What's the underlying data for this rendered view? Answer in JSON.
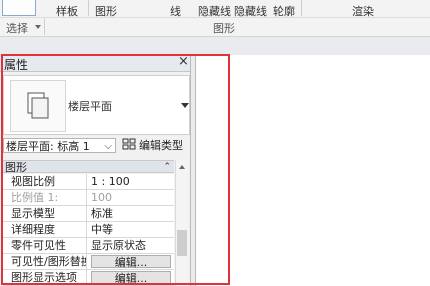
{
  "ribbon": {
    "row1": [
      "样板",
      "图形",
      "线",
      "隐藏线",
      "隐藏线",
      "轮廓",
      "渲染"
    ],
    "select_label": "选择",
    "group_label": "图形"
  },
  "properties": {
    "title": "属性",
    "close_glyph": "×",
    "type_name": "楼层平面",
    "view_selector": "楼层平面: 标高 1",
    "edit_type": "编辑类型",
    "group": "图形",
    "rows": [
      {
        "name": "视图比例",
        "value": "1 : 100",
        "dim": false
      },
      {
        "name": "比例值 1:",
        "value": "100",
        "dim": true
      },
      {
        "name": "显示模型",
        "value": "标准",
        "dim": false
      },
      {
        "name": "详细程度",
        "value": "中等",
        "dim": false
      },
      {
        "name": "零件可见性",
        "value": "显示原状态",
        "dim": false
      },
      {
        "name": "可见性/图形替换",
        "button": "编辑...",
        "dim": false
      },
      {
        "name": "图形显示选项",
        "button": "编辑...",
        "dim": false
      }
    ]
  },
  "colors": {
    "highlight": "#e0323b",
    "header_bg": "#e6e9ef"
  }
}
